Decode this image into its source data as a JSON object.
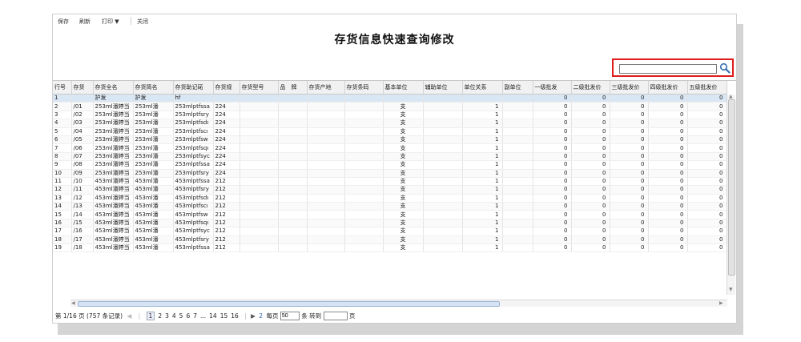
{
  "toolbar": {
    "save_label": "保存",
    "refresh_label": "刷新",
    "print_label": "打印 ▼",
    "close_label": "关闭"
  },
  "page_title": "存货信息快速查询修改",
  "search": {
    "value": "",
    "placeholder": ""
  },
  "columns": [
    "行号",
    "存货",
    "存货全名",
    "存货简名",
    "存货助记砳",
    "存货规",
    "存货型号",
    "品　牌",
    "存货产地",
    "存货条码",
    "基本单位",
    "辅助单位",
    "单位关系",
    "副单位",
    "一级批发",
    "二级批发价",
    "三级批发价",
    "四级批发价",
    "五级批发价"
  ],
  "rows": [
    {
      "no": "1",
      "code": "",
      "full": "护发",
      "short": "护发",
      "memo": "hf",
      "spec": "",
      "unit": "",
      "rel": "",
      "p1": "0",
      "p2": "0",
      "p3": "0",
      "p4": "0",
      "p5": "0"
    },
    {
      "no": "2",
      "code": "/01",
      "full": "253ml潘婷当",
      "short": "253ml潘",
      "memo": "253mlptfssa",
      "spec": "224",
      "unit": "支",
      "rel": "1",
      "p1": "0",
      "p2": "0",
      "p3": "0",
      "p4": "0",
      "p5": "0"
    },
    {
      "no": "3",
      "code": "/02",
      "full": "253ml潘婷当",
      "short": "253ml潘",
      "memo": "253mlptfsry",
      "spec": "224",
      "unit": "支",
      "rel": "1",
      "p1": "0",
      "p2": "0",
      "p3": "0",
      "p4": "0",
      "p5": "0"
    },
    {
      "no": "4",
      "code": "/03",
      "full": "253ml潘婷当",
      "short": "253ml潘",
      "memo": "253mlptfsdı",
      "spec": "224",
      "unit": "支",
      "rel": "1",
      "p1": "0",
      "p2": "0",
      "p3": "0",
      "p4": "0",
      "p5": "0"
    },
    {
      "no": "5",
      "code": "/04",
      "full": "253ml潘婷当",
      "short": "253ml潘",
      "memo": "253mlptfscı",
      "spec": "224",
      "unit": "支",
      "rel": "1",
      "p1": "0",
      "p2": "0",
      "p3": "0",
      "p4": "0",
      "p5": "0"
    },
    {
      "no": "6",
      "code": "/05",
      "full": "253ml潘婷当",
      "short": "253ml潘",
      "memo": "253mlptfsw",
      "spec": "224",
      "unit": "支",
      "rel": "1",
      "p1": "0",
      "p2": "0",
      "p3": "0",
      "p4": "0",
      "p5": "0"
    },
    {
      "no": "7",
      "code": "/06",
      "full": "253ml潘婷当",
      "short": "253ml潘",
      "memo": "253mlptfsqı",
      "spec": "224",
      "unit": "支",
      "rel": "1",
      "p1": "0",
      "p2": "0",
      "p3": "0",
      "p4": "0",
      "p5": "0"
    },
    {
      "no": "8",
      "code": "/07",
      "full": "253ml潘婷当",
      "short": "253ml潘",
      "memo": "253mlptfsyc",
      "spec": "224",
      "unit": "支",
      "rel": "1",
      "p1": "0",
      "p2": "0",
      "p3": "0",
      "p4": "0",
      "p5": "0"
    },
    {
      "no": "9",
      "code": "/08",
      "full": "253ml潘婷当",
      "short": "253ml潘",
      "memo": "253mlptfssa",
      "spec": "224",
      "unit": "支",
      "rel": "1",
      "p1": "0",
      "p2": "0",
      "p3": "0",
      "p4": "0",
      "p5": "0"
    },
    {
      "no": "10",
      "code": "/09",
      "full": "253ml潘婷当",
      "short": "253ml潘",
      "memo": "253mlptfsry",
      "spec": "224",
      "unit": "支",
      "rel": "1",
      "p1": "0",
      "p2": "0",
      "p3": "0",
      "p4": "0",
      "p5": "0"
    },
    {
      "no": "11",
      "code": "/10",
      "full": "453ml潘婷当",
      "short": "453ml潘",
      "memo": "453mlptfssa",
      "spec": "212",
      "unit": "支",
      "rel": "1",
      "p1": "0",
      "p2": "0",
      "p3": "0",
      "p4": "0",
      "p5": "0"
    },
    {
      "no": "12",
      "code": "/11",
      "full": "453ml潘婷当",
      "short": "453ml潘",
      "memo": "453mlptfsry",
      "spec": "212",
      "unit": "支",
      "rel": "1",
      "p1": "0",
      "p2": "0",
      "p3": "0",
      "p4": "0",
      "p5": "0"
    },
    {
      "no": "13",
      "code": "/12",
      "full": "453ml潘婷当",
      "short": "453ml潘",
      "memo": "453mlptfsdı",
      "spec": "212",
      "unit": "支",
      "rel": "1",
      "p1": "0",
      "p2": "0",
      "p3": "0",
      "p4": "0",
      "p5": "0"
    },
    {
      "no": "14",
      "code": "/13",
      "full": "453ml潘婷当",
      "short": "453ml潘",
      "memo": "453mlptfscı",
      "spec": "212",
      "unit": "支",
      "rel": "1",
      "p1": "0",
      "p2": "0",
      "p3": "0",
      "p4": "0",
      "p5": "0"
    },
    {
      "no": "15",
      "code": "/14",
      "full": "453ml潘婷当",
      "short": "453ml潘",
      "memo": "453mlptfsw",
      "spec": "212",
      "unit": "支",
      "rel": "1",
      "p1": "0",
      "p2": "0",
      "p3": "0",
      "p4": "0",
      "p5": "0"
    },
    {
      "no": "16",
      "code": "/15",
      "full": "453ml潘婷当",
      "short": "453ml潘",
      "memo": "453mlptfsqı",
      "spec": "212",
      "unit": "支",
      "rel": "1",
      "p1": "0",
      "p2": "0",
      "p3": "0",
      "p4": "0",
      "p5": "0"
    },
    {
      "no": "17",
      "code": "/16",
      "full": "453ml潘婷当",
      "short": "453ml潘",
      "memo": "453mlptfsyc",
      "spec": "212",
      "unit": "支",
      "rel": "1",
      "p1": "0",
      "p2": "0",
      "p3": "0",
      "p4": "0",
      "p5": "0"
    },
    {
      "no": "18",
      "code": "/17",
      "full": "453ml潘婷当",
      "short": "453ml潘",
      "memo": "453mlptfsry",
      "spec": "212",
      "unit": "支",
      "rel": "1",
      "p1": "0",
      "p2": "0",
      "p3": "0",
      "p4": "0",
      "p5": "0"
    },
    {
      "no": "19",
      "code": "/18",
      "full": "453ml潘婷当",
      "short": "453ml潘",
      "memo": "453mlptfssa",
      "spec": "212",
      "unit": "支",
      "rel": "1",
      "p1": "0",
      "p2": "0",
      "p3": "0",
      "p4": "0",
      "p5": "0"
    }
  ],
  "pager": {
    "summary": "第 1/16 页 (757 条记录)",
    "pages": [
      "1",
      "2",
      "3",
      "4",
      "5",
      "6",
      "7",
      "...",
      "14",
      "15",
      "16"
    ],
    "current": "1",
    "jump_num": "2",
    "per_page_label": "每页",
    "per_page_value": "50",
    "per_page_unit": "条 转到",
    "goto_value": "",
    "goto_unit": "页"
  },
  "colors": {
    "accent_red": "#e11b1b",
    "selected_row": "#d9e6f4"
  },
  "icons": {
    "search": "search-icon"
  }
}
